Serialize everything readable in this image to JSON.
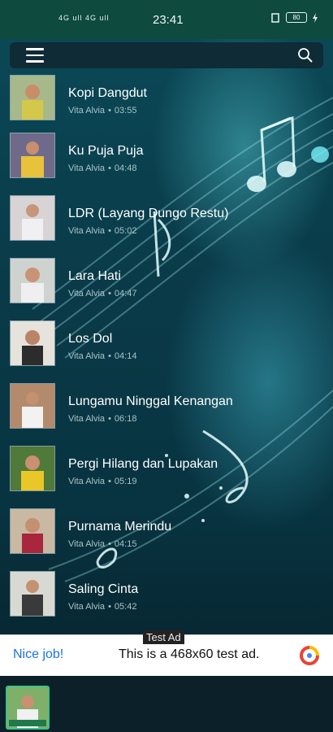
{
  "status_bar": {
    "network": "4G ull 4G ull",
    "time": "23:41",
    "battery": "80"
  },
  "songs": [
    {
      "title": "Kopi Dangdut",
      "artist": "Vita Alvia",
      "duration": "03:55"
    },
    {
      "title": "Ku Puja Puja",
      "artist": "Vita Alvia",
      "duration": "04:48"
    },
    {
      "title": "LDR (Layang Dungo Restu)",
      "artist": "Vita Alvia",
      "duration": "05:02"
    },
    {
      "title": "Lara Hati",
      "artist": "Vita Alvia",
      "duration": "04:47"
    },
    {
      "title": "Los Dol",
      "artist": "Vita Alvia",
      "duration": "04:14"
    },
    {
      "title": "Lungamu Ninggal Kenangan",
      "artist": "Vita Alvia",
      "duration": "06:18"
    },
    {
      "title": "Pergi Hilang dan Lupakan",
      "artist": "Vita Alvia",
      "duration": "05:19"
    },
    {
      "title": "Purnama Merindu",
      "artist": "Vita Alvia",
      "duration": "04:15"
    },
    {
      "title": "Saling Cinta",
      "artist": "Vita Alvia",
      "duration": "05:42"
    }
  ],
  "separator": "•",
  "ad": {
    "label": "Test Ad",
    "nice": "Nice job!",
    "text": "This is a 468x60 test ad."
  },
  "colors": {
    "status_bar": "#0e4a3e",
    "app_bar": "#0f2b36",
    "ad_link": "#1a73e8",
    "now_playing_border": "#3bc38a"
  },
  "icons": {
    "menu": "hamburger-menu-icon",
    "search": "search-icon",
    "ad_logo": "admob-logo-icon"
  }
}
